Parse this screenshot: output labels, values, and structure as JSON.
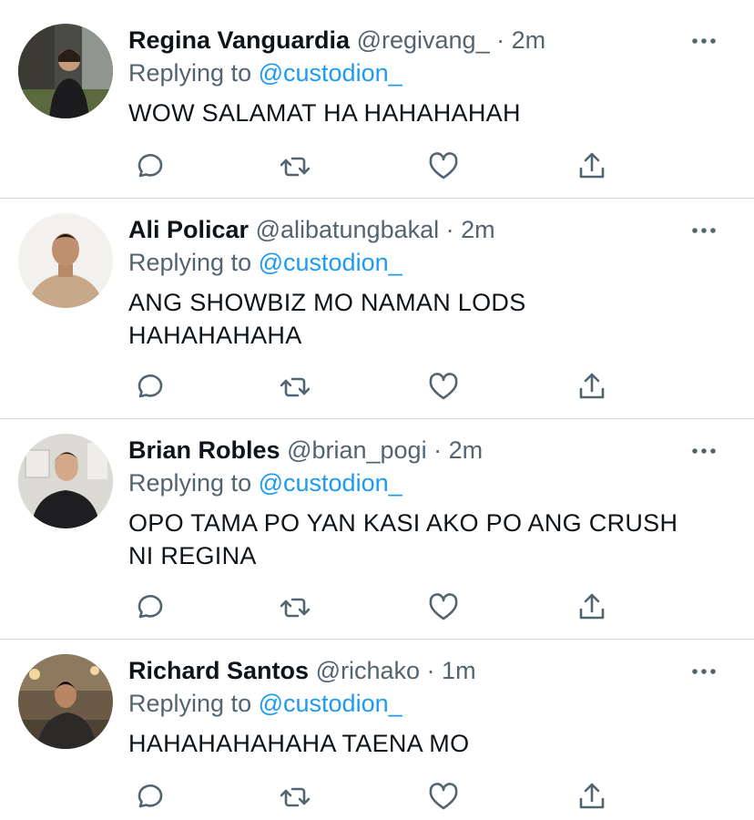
{
  "tweets": [
    {
      "name": "Regina Vanguardia",
      "handle": "@regivang_",
      "dot": "·",
      "time": "2m",
      "replying_prefix": "Replying to",
      "replying_to": "@custodion_",
      "text": "WOW SALAMAT HA HAHAHAHAH",
      "text2": ""
    },
    {
      "name": "Ali Policar",
      "handle": "@alibatungbakal",
      "dot": "·",
      "time": "2m",
      "replying_prefix": "Replying to",
      "replying_to": "@custodion_",
      "text": "ANG SHOWBIZ MO NAMAN LODS",
      "text2": "HAHAHAHAHA"
    },
    {
      "name": "Brian Robles",
      "handle": "@brian_pogi",
      "dot": "·",
      "time": "2m",
      "replying_prefix": "Replying to",
      "replying_to": "@custodion_",
      "text": "OPO TAMA PO YAN KASI AKO PO ANG CRUSH",
      "text2": "NI REGINA"
    },
    {
      "name": "Richard Santos",
      "handle": "@richako",
      "dot": "·",
      "time": "1m",
      "replying_prefix": "Replying to",
      "replying_to": "@custodion_",
      "text": "HAHAHAHAHAHA TAENA MO",
      "text2": ""
    }
  ],
  "icons": {
    "reply": "reply-icon",
    "retweet": "retweet-icon",
    "like": "heart-icon",
    "share": "share-icon",
    "more": "more-icon"
  },
  "colors": {
    "name": "#0f1419",
    "secondary": "#536471",
    "mention": "#1d9bf0",
    "divider": "#cfd9de"
  }
}
